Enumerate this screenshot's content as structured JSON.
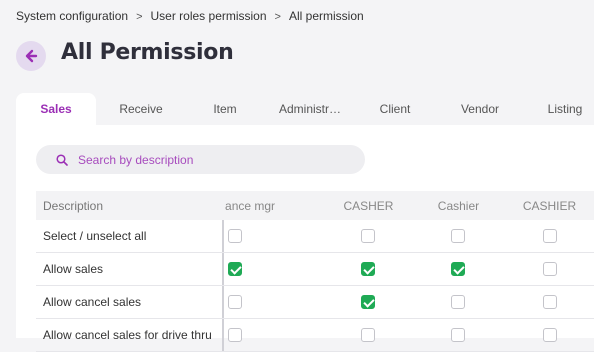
{
  "breadcrumb": {
    "items": [
      "System configuration",
      "User roles permission",
      "All permission"
    ],
    "separator": ">"
  },
  "header": {
    "back_icon": "arrow-left-icon",
    "title": "All Permission"
  },
  "tabs": [
    {
      "label": "Sales",
      "active": true
    },
    {
      "label": "Receive",
      "active": false
    },
    {
      "label": "Item",
      "active": false
    },
    {
      "label": "Administr…",
      "active": false
    },
    {
      "label": "Client",
      "active": false
    },
    {
      "label": "Vendor",
      "active": false
    },
    {
      "label": "Listing",
      "active": false
    }
  ],
  "search": {
    "icon": "search-icon",
    "placeholder": "Search by description",
    "value": ""
  },
  "table": {
    "desc_header": "Description",
    "roles": [
      "ance mgr",
      "CASHER",
      "Cashier",
      "CASHIER"
    ],
    "rows": [
      {
        "label": "Select / unselect all",
        "checks": [
          false,
          false,
          false,
          false
        ]
      },
      {
        "label": "Allow sales",
        "checks": [
          true,
          true,
          true,
          false
        ]
      },
      {
        "label": "Allow cancel sales",
        "checks": [
          false,
          true,
          false,
          false
        ]
      },
      {
        "label": "Allow cancel sales for drive thru",
        "checks": [
          false,
          false,
          false,
          false
        ]
      }
    ]
  },
  "colors": {
    "accent": "#9b2fb5",
    "check": "#1faa55",
    "back_bg": "#e4daef"
  }
}
